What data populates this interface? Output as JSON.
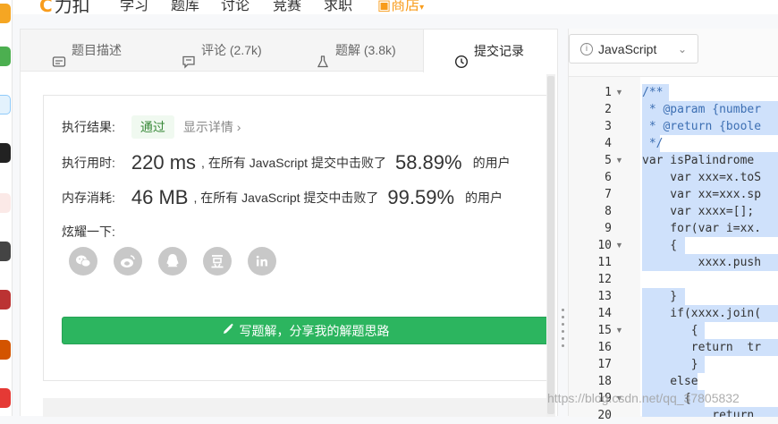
{
  "nav": {
    "logo": "力扣",
    "items": [
      "学习",
      "题库",
      "讨论",
      "竞赛",
      "求职"
    ],
    "shop": "商店"
  },
  "tabs": [
    {
      "label": "题目描述",
      "icon": "description-icon"
    },
    {
      "label": "评论 (2.7k)",
      "icon": "comment-icon"
    },
    {
      "label": "题解 (3.8k)",
      "icon": "flask-icon"
    },
    {
      "label": "提交记录",
      "icon": "clock-icon"
    }
  ],
  "result": {
    "status_label": "执行结果:",
    "status_value": "通过",
    "details": "显示详情 ›",
    "runtime_label": "执行用时:",
    "runtime_value": "220 ms",
    "runtime_mid": ", 在所有 JavaScript 提交中击败了",
    "runtime_pct": "58.89%",
    "runtime_users": "的用户",
    "memory_label": "内存消耗:",
    "memory_value": "46 MB",
    "memory_mid": ", 在所有 JavaScript 提交中击败了",
    "memory_pct": "99.59%",
    "memory_users": "的用户",
    "share_label": "炫耀一下:",
    "share_icons": [
      "wechat-icon",
      "weibo-icon",
      "qq-icon",
      "douban-icon",
      "linkedin-icon"
    ],
    "write_button": "写题解，分享我的解题思路"
  },
  "editor": {
    "language": "JavaScript",
    "line_numbers": [
      "1",
      "2",
      "3",
      "4",
      "5",
      "6",
      "7",
      "8",
      "9",
      "10",
      "11",
      "12",
      "13",
      "14",
      "15",
      "16",
      "17",
      "18",
      "19",
      "20"
    ],
    "lines": [
      "/**",
      " * @param {number",
      " * @return {boole",
      " */",
      "var isPalindrome ",
      "    var xxx=x.toS",
      "    var xx=xxx.sp",
      "    var xxxx=[];",
      "    for(var i=xx.",
      "    {",
      "        xxxx.push",
      "",
      "    }",
      "    if(xxxx.join(",
      "       {",
      "       return  tr",
      "       }",
      "    else",
      "      {",
      "          return"
    ]
  },
  "watermark": "https://blog.csdn.net/qq_37805832"
}
